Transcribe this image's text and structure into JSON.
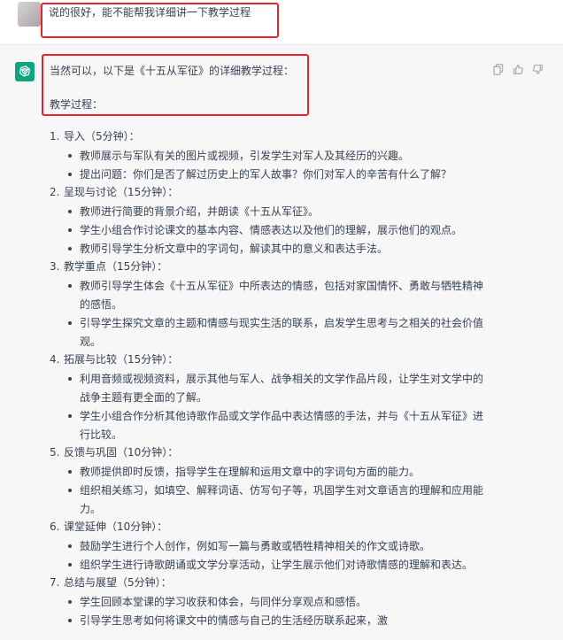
{
  "user_message": {
    "text": "说的很好，能不能帮我详细讲一下教学过程"
  },
  "assistant_message": {
    "intro": "当然可以，以下是《十五从军征》的详细教学过程：",
    "section_title": "教学过程：",
    "actions": {
      "copy_icon": "copy-icon",
      "like_icon": "thumbs-up-icon",
      "dislike_icon": "thumbs-down-icon"
    },
    "steps": [
      {
        "number": "1.",
        "title": "导入（5分钟）：",
        "bullets": [
          "教师展示与军队有关的图片或视频，引发学生对军人及其经历的兴趣。",
          "提出问题：你们是否了解过历史上的军人故事？你们对军人的辛苦有什么了解？"
        ]
      },
      {
        "number": "2.",
        "title": "呈现与讨论（15分钟）：",
        "bullets": [
          "教师进行简要的背景介绍，并朗读《十五从军征》。",
          "学生小组合作讨论课文的基本内容、情感表达以及他们的理解，展示他们的观点。",
          "教师引导学生分析文章中的字词句，解读其中的意义和表达手法。"
        ]
      },
      {
        "number": "3.",
        "title": "教学重点（15分钟）：",
        "bullets": [
          "教师引导学生体会《十五从军征》中所表达的情感，包括对家国情怀、勇敢与牺牲精神的感悟。",
          "引导学生探究文章的主题和情感与现实生活的联系，启发学生思考与之相关的社会价值观。"
        ]
      },
      {
        "number": "4.",
        "title": "拓展与比较（15分钟）：",
        "bullets": [
          "利用音频或视频资料，展示其他与军人、战争相关的文学作品片段，让学生对文学中的战争主题有更全面的了解。",
          "学生小组合作分析其他诗歌作品或文学作品中表达情感的手法，并与《十五从军征》进行比较。"
        ]
      },
      {
        "number": "5.",
        "title": "反馈与巩固（10分钟）：",
        "bullets": [
          "教师提供即时反馈，指导学生在理解和运用文章中的字词句方面的能力。",
          "组织相关练习，如填空、解释词语、仿写句子等，巩固学生对文章语言的理解和应用能力。"
        ]
      },
      {
        "number": "6.",
        "title": "课堂延伸（10分钟）：",
        "bullets": [
          "鼓励学生进行个人创作，例如写一篇与勇敢或牺牲精神相关的作文或诗歌。",
          "组织学生进行诗歌朗诵或文学分享活动，让学生展示他们对诗歌情感的理解和表达。"
        ]
      },
      {
        "number": "7.",
        "title": "总结与展望（5分钟）：",
        "bullets": [
          "学生回顾本堂课的学习收获和体会，与同伴分享观点和感悟。",
          "引导学生思考如何将课文中的情感与自己的生活经历联系起来，激"
        ]
      }
    ]
  },
  "colors": {
    "highlight": "#e8232b",
    "assistant_bg": "#f7f7f8",
    "brand": "#10a37f",
    "text": "#374151"
  }
}
